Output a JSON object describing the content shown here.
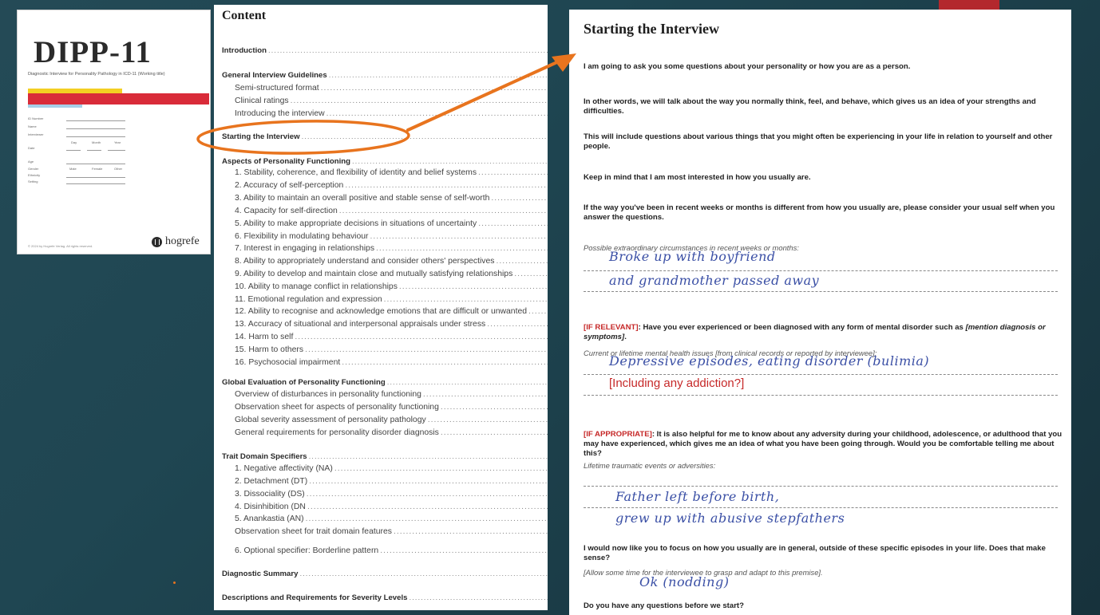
{
  "cover": {
    "title": "DIPP-11",
    "subtitle": "Diagnostic Interview for Personality Pathology in ICD-11 (Working title)",
    "form_labels": [
      "ID Number",
      "Name",
      "Interviewer",
      "Day",
      "Month",
      "Year",
      "Date",
      "Age",
      "Gender",
      "Male",
      "Female",
      "Other",
      "Ethnicity",
      "Setting"
    ],
    "copyright": "© 2024 by Hogrefe Verlag. All rights reserved.",
    "publisher": "hogrefe",
    "colors": {
      "yellow": "#f3cf23",
      "red": "#d92b39",
      "blue": "#a6cfe7"
    }
  },
  "contents": {
    "heading": "Content",
    "introduction": "Introduction",
    "guidelines": {
      "title": "General Interview Guidelines",
      "items": [
        "Semi-structured format",
        "Clinical ratings",
        "Introducing the interview"
      ]
    },
    "starting": "Starting the Interview",
    "aspects": {
      "title": "Aspects of Personality Functioning",
      "items": [
        "1.  Stability, coherence, and flexibility of identity and belief systems",
        "2.  Accuracy of self-perception",
        "3.  Ability to maintain an overall positive and stable sense of self-worth",
        "4.  Capacity for self-direction",
        "5.  Ability to make appropriate decisions in situations of uncertainty",
        "6.  Flexibility in modulating behaviour",
        "7.   Interest in engaging in relationships",
        "8.  Ability to appropriately understand and consider others' perspectives",
        "9.  Ability to develop and maintain close and mutually satisfying relationships",
        "10. Ability to manage conflict in relationships",
        "11. Emotional regulation and expression",
        "12. Ability to recognise and acknowledge emotions that are difficult or unwanted",
        "13. Accuracy of situational and interpersonal appraisals under stress",
        "14. Harm to self",
        "15. Harm to others",
        "16. Psychosocial impairment"
      ]
    },
    "global": {
      "title": "Global Evaluation of Personality Functioning",
      "items": [
        "Overview of disturbances in personality functioning",
        "Observation sheet for aspects of personality functioning",
        "Global severity assessment of personality pathology",
        "General requirements for personality disorder diagnosis"
      ]
    },
    "trait": {
      "title": "Trait Domain Specifiers",
      "items": [
        "1.  Negative affectivity (NA)",
        "2.  Detachment (DT)",
        "3.  Dissociality (DS)",
        "4.  Disinhibition (DN",
        "5.  Anankastia (AN)",
        "Observation sheet for trait domain features",
        "6.  Optional specifier: Borderline pattern"
      ]
    },
    "summary": "Diagnostic Summary",
    "descriptions": "Descriptions and Requirements for Severity Levels"
  },
  "interview": {
    "heading": "Starting the Interview",
    "p1": "I am going to ask you some questions about your personality or how you are as a person.",
    "p2": "In other words, we will talk about the way you normally think, feel, and behave, which gives us an idea of your strengths and difficulties.",
    "p3": "This will include questions about various things that you might often be experiencing in your life in relation to yourself and other people.",
    "p4": "Keep in mind that I am most interested in how you usually are.",
    "p5": "If the way you've been in recent weeks or months is different from how you usually are, please consider your usual self when you answer the questions.",
    "circumstances_label": "Possible extraordinary circumstances in recent weeks or months:",
    "hw_circumstances_1": "Broke up with boyfriend",
    "hw_circumstances_2": "and grandmother passed away",
    "if_relevant_tag": "[IF RELEVANT]",
    "if_relevant_q": ": Have you ever experienced or been diagnosed with any form of mental disorder such as ",
    "if_relevant_mention": "[mention diagnosis or symptoms]",
    "period": ".",
    "mental_label": "Current or lifetime mental health issues [from clinical records or reported by interviewee]:",
    "hw_mental": "Depressive episodes, eating disorder (bulimia)",
    "addiction_note": "[Including any addiction?]",
    "if_appropriate_tag": "[IF APPROPRIATE]",
    "if_appropriate_q": ": It is also helpful for me to know about any adversity during your childhood, adolescence, or adulthood that you may have experienced, which gives me an idea of what you have been going through. Would you be comfortable telling me about this?",
    "trauma_label": "Lifetime traumatic events or adversities:",
    "hw_trauma_1": "Father left before birth,",
    "hw_trauma_2": "grew up with abusive stepfathers",
    "focus_q": "I would now like you to focus on how you usually are in general, outside of these specific episodes in your life. Does that make sense?",
    "allow_note": "[Allow some time for the interviewee to grasp and adapt to this premise].",
    "hw_ok": "Ok (nodding)",
    "questions_q": "Do you have any questions before we start?"
  },
  "colors": {
    "annotation_orange": "#e8741e",
    "handwriting_blue": "#3a4fa5",
    "note_red": "#c62828",
    "accent_red": "#b3282d"
  }
}
